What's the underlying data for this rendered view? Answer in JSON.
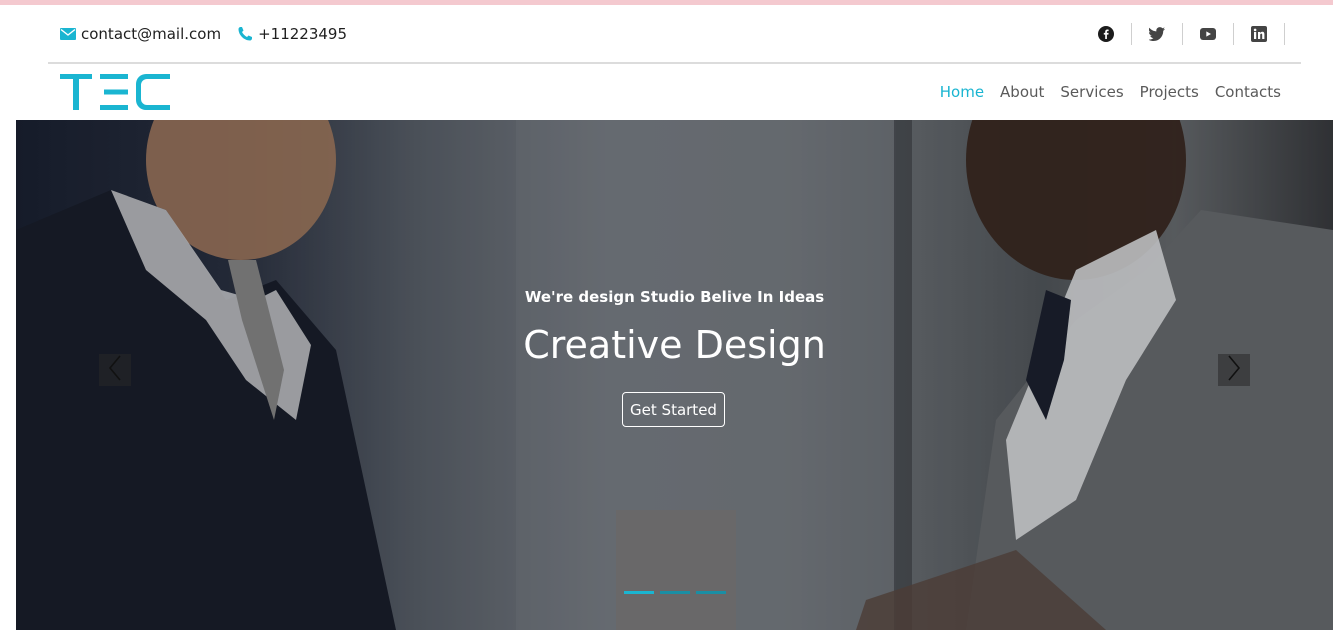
{
  "contact": {
    "email": "contact@mail.com",
    "phone": "+11223495",
    "email_icon": "envelope-icon",
    "phone_icon": "phone-icon"
  },
  "socials": [
    {
      "icon": "facebook-icon"
    },
    {
      "icon": "twitter-icon"
    },
    {
      "icon": "youtube-icon"
    },
    {
      "icon": "linkedin-icon"
    }
  ],
  "brand": {
    "logo_text": "TEC",
    "accent_color": "#1ab5d1"
  },
  "nav": {
    "items": [
      "Home",
      "About",
      "Services",
      "Projects",
      "Contacts"
    ],
    "active": "Home"
  },
  "hero": {
    "subtitle": "We're design Studio Belive In Ideas",
    "title": "Creative Design",
    "cta_label": "Get Started",
    "slides_count": 3,
    "active_slide": 1,
    "prev_icon": "chevron-left-icon",
    "next_icon": "chevron-right-icon"
  }
}
